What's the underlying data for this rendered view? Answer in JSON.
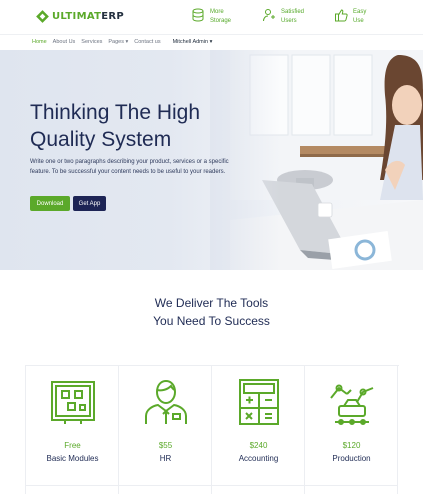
{
  "brand": {
    "name_prefix": "ULTIMAT",
    "name_suffix": "ERP"
  },
  "header_features": [
    {
      "icon": "database-icon",
      "line1": "More",
      "line2": "Storage"
    },
    {
      "icon": "satisfied-users-icon",
      "line1": "Satisfied",
      "line2": "Users"
    },
    {
      "icon": "thumbs-up-icon",
      "line1": "Easy",
      "line2": "Use"
    }
  ],
  "nav": {
    "items": [
      "Home",
      "About Us",
      "Services",
      "Pages ▾",
      "Contact us"
    ],
    "user": "Mitchell Admin ▾"
  },
  "hero": {
    "title": "Thinking The High Quality System",
    "text": "Write one or two paragraphs describing your product, services or a specific feature. To be successful your content needs to be useful to your readers.",
    "download_label": "Download",
    "app_label": "Get App"
  },
  "tools": {
    "title_line1": "We Deliver The Tools",
    "title_line2": "You Need To Success",
    "cards": [
      {
        "icon": "modules-icon",
        "price": "Free",
        "name": "Basic Modules"
      },
      {
        "icon": "hr-person-icon",
        "price": "$55",
        "name": "HR"
      },
      {
        "icon": "calculator-icon",
        "price": "$240",
        "name": "Accounting"
      },
      {
        "icon": "robot-arm-icon",
        "price": "$120",
        "name": "Production"
      }
    ]
  },
  "colors": {
    "accent": "#5ba92a",
    "navy": "#1d2455",
    "heading": "#1f2b54"
  }
}
